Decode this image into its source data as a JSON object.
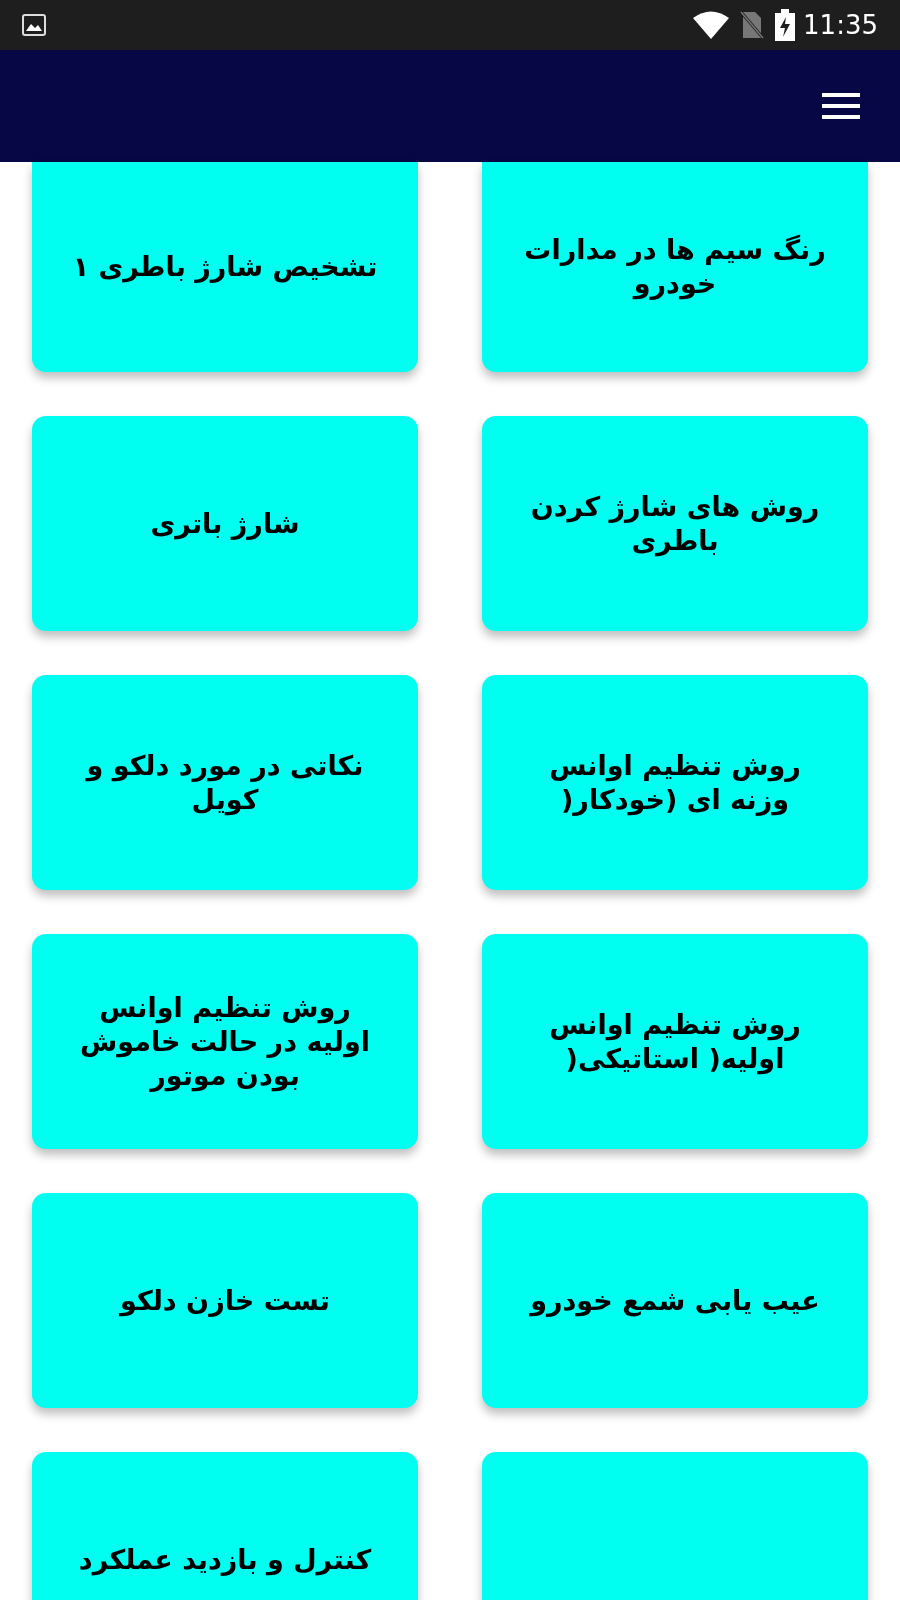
{
  "status_bar": {
    "time": "11:35"
  },
  "card_rows": [
    {
      "right_card": {
        "kind": "text",
        "title": "رنگ سیم ها در مدارات خودرو"
      },
      "left_card": {
        "kind": "text",
        "title": "تشخیص شارژ باطری ۱"
      }
    },
    {
      "right_card": {
        "kind": "text",
        "title": "روش های شارژ کردن باطری"
      },
      "left_card": {
        "kind": "text",
        "title": "شارژ باتری"
      }
    },
    {
      "right_card": {
        "kind": "text",
        "title": "روش تنظیم اوانس وزنه ای (خودکار("
      },
      "left_card": {
        "kind": "text",
        "title": "نکاتی در مورد دلکو و کویل"
      }
    },
    {
      "right_card": {
        "kind": "text",
        "title": "روش تنظیم اوانس اولیه( استاتیکی("
      },
      "left_card": {
        "kind": "text",
        "title": "روش تنظیم اوانس اولیه در حالت خاموش بودن موتور"
      }
    },
    {
      "right_card": {
        "kind": "text",
        "title": "عیب یابی شمع خودرو"
      },
      "left_card": {
        "kind": "text",
        "title": "تست خازن دلکو"
      }
    },
    {
      "right_card": {
        "kind": "blank"
      },
      "left_card": {
        "kind": "text",
        "title": "کنترل و بازدید عملکرد"
      }
    }
  ]
}
